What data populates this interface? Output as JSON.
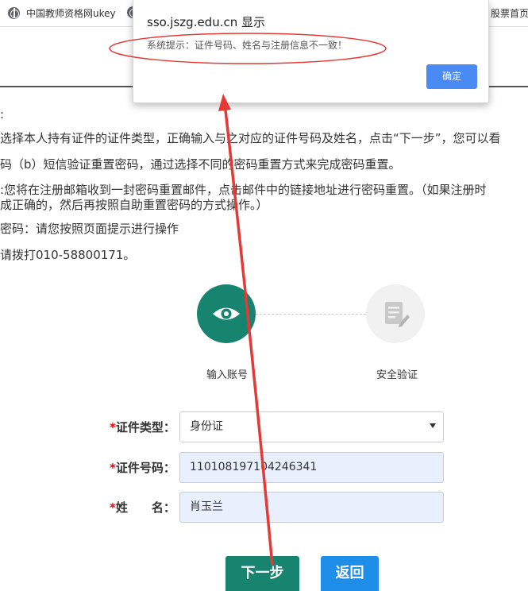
{
  "bookmarks": [
    {
      "label": "中国教师资格网ukey",
      "icon": "globe-icon"
    },
    {
      "label": "股票首页",
      "icon": ""
    }
  ],
  "instructions": [
    ":",
    "选择本人持有证件的证件类型，正确输入与之对应的证件号码及姓名，点击“下一步”，您可以看",
    "码（b）短信验证重置密码，通过选择不同的密码重置方式来完成密码重置。",
    ":您将在注册邮箱收到一封密码重置邮件，点击邮件中的链接地址进行密码重置。（如果注册时",
    "成正确的，然后再按照自助重置密码的方式操作。）",
    "密码：请您按照页面提示进行操作",
    "请拨打010-58800171。"
  ],
  "steps": [
    {
      "label": "输入账号",
      "icon": "eye-icon",
      "active": true
    },
    {
      "label": "安全验证",
      "icon": "document-edit-icon",
      "active": false
    }
  ],
  "form": {
    "required_mark": "*",
    "id_type": {
      "label": "证件类型：",
      "value": "身份证"
    },
    "id_number": {
      "label": "证件号码：",
      "value": "110108197104246341"
    },
    "name": {
      "label": "姓　　名：",
      "value": "肖玉兰"
    }
  },
  "buttons": {
    "next": "下一步",
    "back": "返回"
  },
  "dialog": {
    "title": "sso.jszg.edu.cn 显示",
    "message": "系统提示：证件号码、姓名与注册信息不一致！",
    "ok": "确定"
  },
  "colors": {
    "primary_green": "#16846e",
    "back_blue": "#1e8ee8",
    "dialog_button": "#4a8af4",
    "annotation_red": "#e53935"
  }
}
